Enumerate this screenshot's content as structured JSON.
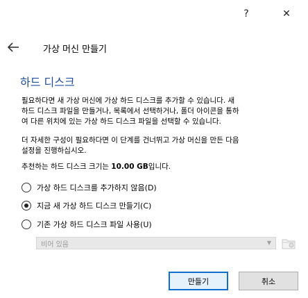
{
  "window": {
    "help_label": "?",
    "close_label": "✕"
  },
  "header": {
    "title": "가상 머신 만들기"
  },
  "section": {
    "title": "하드 디스크"
  },
  "description": {
    "p1": "필요하다면 새 가상 머신에 가상 하드 디스크를 추가할 수 있습니다. 새\n하드 디스크 파일을 만들거나, 목록에서 선택하거나, 폴더 아이콘을 통하\n여 다른 위치에 있는 가상 하드 디스크 파일을 선택할 수 있습니다.",
    "p2": "더 자세한 구성이 필요하다면 이 단계를 건너뛰고 가상 머신을 만든 다음\n설정을 진행하십시오.",
    "recommend_prefix": "추천하는 하드 디스크 크기는 ",
    "recommend_size": "10.00 GB",
    "recommend_suffix": "입니다."
  },
  "options": [
    {
      "label": "가상 하드 디스크를 추가하지 않음(D)",
      "checked": false
    },
    {
      "label": "지금 새 가상 하드 디스크 만들기(C)",
      "checked": true
    },
    {
      "label": "기존 가상 하드 디스크 파일 사용(U)",
      "checked": false
    }
  ],
  "disk_select": {
    "value": "비어 있음",
    "enabled": false
  },
  "buttons": {
    "create": "만들기",
    "cancel": "취소"
  },
  "colors": {
    "section_title": "#1f4e9e",
    "default_button_border": "#0f6fd1"
  },
  "icons": {
    "back": "arrow-left-icon",
    "folder": "folder-icon",
    "dropdown": "chevron-down-icon"
  }
}
